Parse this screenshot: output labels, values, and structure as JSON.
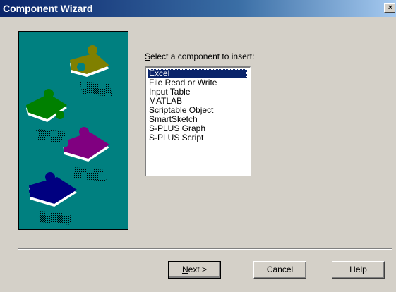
{
  "window": {
    "title": "Component Wizard",
    "close_glyph": "×"
  },
  "prompt": {
    "accel": "S",
    "rest": "elect a component to insert:"
  },
  "components": [
    "Excel",
    "File Read or Write",
    "Input Table",
    "MATLAB",
    "Scriptable Object",
    "SmartSketch",
    "S-PLUS Graph",
    "S-PLUS Script"
  ],
  "selected_index": 0,
  "buttons": {
    "next": {
      "accel": "N",
      "rest": "ext >"
    },
    "cancel": "Cancel",
    "help": "Help"
  },
  "colors": {
    "title_bar": "#0a246a",
    "panel": "#008080",
    "selection": "#0a246a",
    "pieces": [
      "#808000",
      "#008000",
      "#800080",
      "#000080"
    ]
  }
}
